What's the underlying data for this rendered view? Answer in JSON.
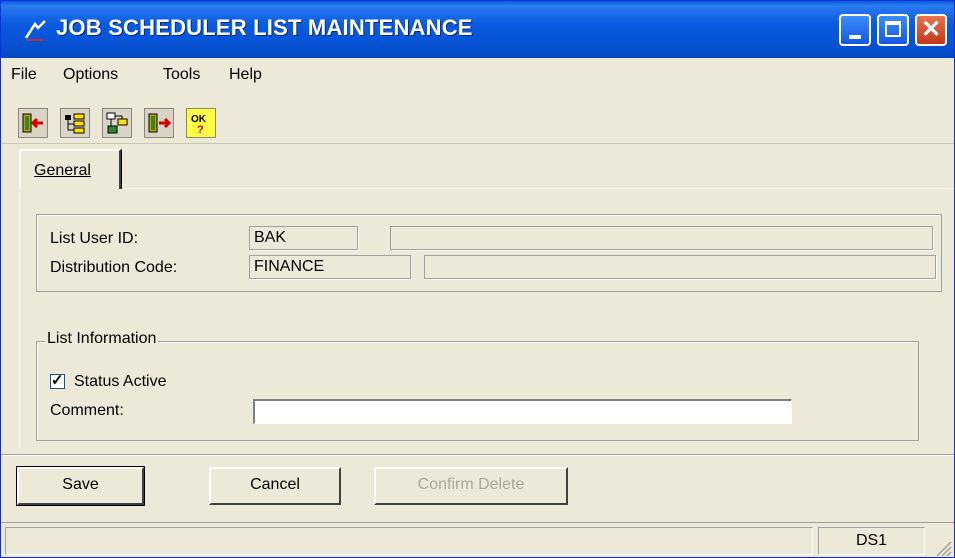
{
  "window": {
    "title": "JOB SCHEDULER LIST MAINTENANCE"
  },
  "menu": [
    "File",
    "Options",
    "Tools",
    "Help"
  ],
  "toolbar": [
    "exit-icon",
    "tree-icon",
    "workflow-icon",
    "exit-right-icon",
    "ok-help-icon"
  ],
  "tab": {
    "label": "General"
  },
  "ids": {
    "list_user_id_label": "List User ID:",
    "list_user_id_value": "BAK",
    "list_user_id_desc": "",
    "distribution_code_label": "Distribution Code:",
    "distribution_code_value": "FINANCE",
    "distribution_code_desc": ""
  },
  "list_info": {
    "legend": "List Information",
    "status_label": "Status Active",
    "status_checked": true,
    "comment_label": "Comment:",
    "comment_value": ""
  },
  "buttons": {
    "save": "Save",
    "cancel": "Cancel",
    "confirm_delete": "Confirm Delete"
  },
  "status": {
    "left": "",
    "right": "DS1"
  }
}
